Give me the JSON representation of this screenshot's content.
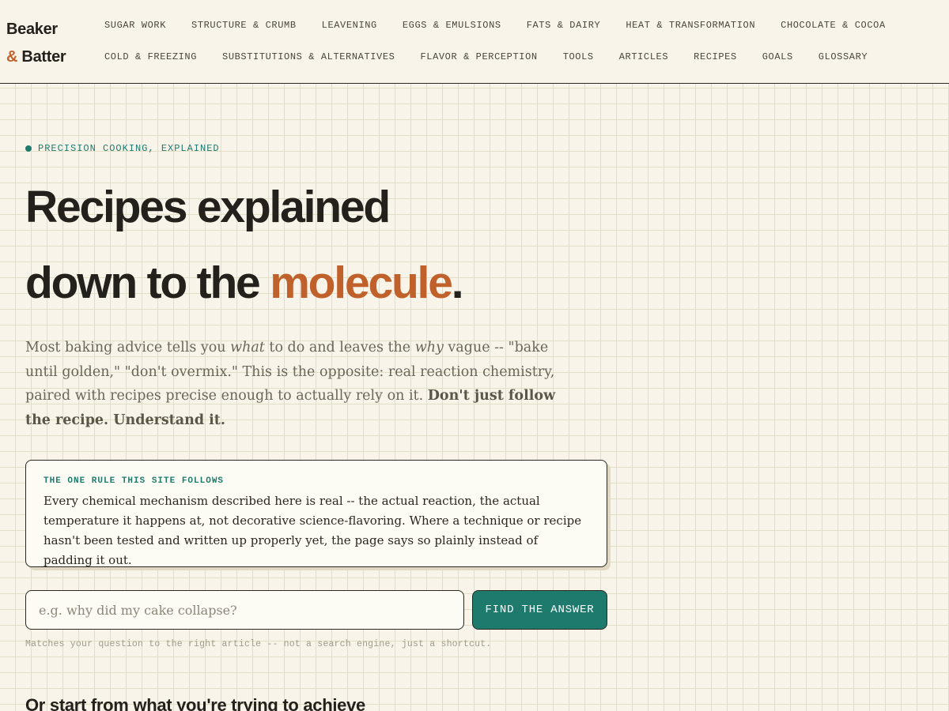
{
  "brand": {
    "line1": "Beaker",
    "amp": "&",
    "line2": "Batter"
  },
  "nav": {
    "row1": [
      "SUGAR WORK",
      "STRUCTURE & CRUMB",
      "LEAVENING",
      "EGGS & EMULSIONS",
      "FATS & DAIRY",
      "HEAT & TRANSFORMATION",
      "CHOCOLATE & COCOA"
    ],
    "row2": [
      "COLD & FREEZING",
      "SUBSTITUTIONS & ALTERNATIVES",
      "FLAVOR & PERCEPTION",
      "TOOLS",
      "ARTICLES",
      "RECIPES",
      "GOALS",
      "GLOSSARY"
    ]
  },
  "hero": {
    "eyebrow": "PRECISION COOKING, EXPLAINED",
    "headline_line1": "Recipes explained",
    "headline_line2_prefix": "down to the ",
    "headline_accent": "molecule",
    "headline_period": ".",
    "lede": {
      "p1": "Most baking advice tells you ",
      "em1": "what",
      "p2": " to do and leaves the ",
      "em2": "why",
      "p3": " vague -- \"bake until golden,\" \"don't overmix.\" This is the opposite: real reaction chemistry, paired with recipes precise enough to actually rely on it. ",
      "bold": "Don't just follow the recipe. Understand it."
    }
  },
  "rule": {
    "title": "THE ONE RULE THIS SITE FOLLOWS",
    "body": "Every chemical mechanism described here is real -- the actual reaction, the actual temperature it happens at, not decorative science-flavoring. Where a technique or recipe hasn't been tested and written up properly yet, the page says so plainly instead of padding it out."
  },
  "search": {
    "placeholder": "e.g. why did my cake collapse?",
    "button_label": "FIND THE ANSWER",
    "hint": "Matches your question to the right article -- not a search engine, just a shortcut."
  },
  "goals_section": {
    "title": "Or start from what you're trying to achieve"
  },
  "colors": {
    "accent": "#c0602a",
    "teal": "#1f7a6e",
    "background": "#f8f4e9",
    "ink": "#24211c"
  }
}
